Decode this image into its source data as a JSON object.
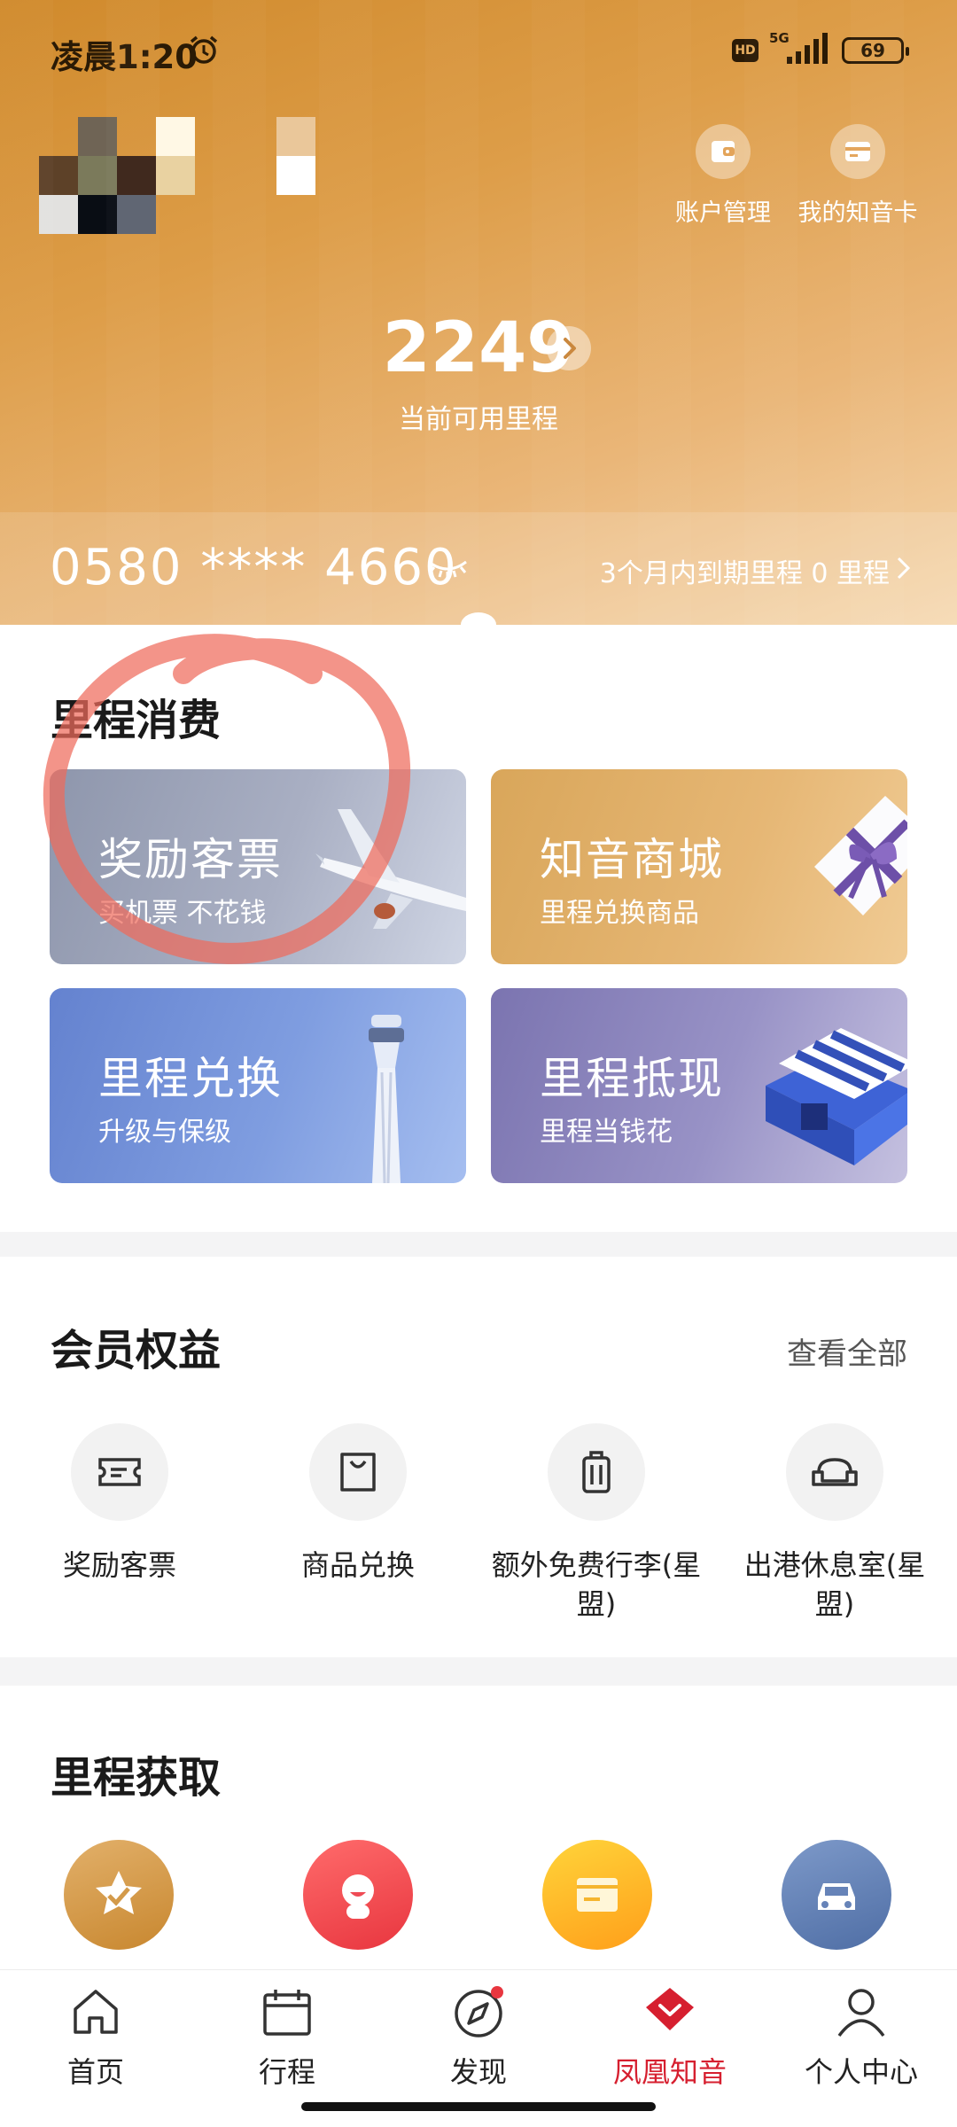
{
  "status_bar": {
    "time": "凌晨1:20",
    "network": "5G",
    "hd_badge": "HD",
    "battery": "69",
    "icons": [
      "alarm-icon",
      "signal-icon",
      "battery-icon"
    ]
  },
  "header": {
    "quick_actions": [
      {
        "label": "账户管理",
        "icon": "wallet-icon"
      },
      {
        "label": "我的知音卡",
        "icon": "card-icon"
      }
    ],
    "miles": "2249",
    "miles_caption": "当前可用里程",
    "card_number": "0580 **** 4660",
    "expire_text": "3个月内到期里程 0 里程"
  },
  "redeem": {
    "title": "里程消费",
    "tiles": [
      {
        "title": "奖励客票",
        "subtitle": "买机票 不花钱",
        "art": "airplane"
      },
      {
        "title": "知音商城",
        "subtitle": "里程兑换商品",
        "art": "gift-box"
      },
      {
        "title": "里程兑换",
        "subtitle": "升级与保级",
        "art": "control-tower"
      },
      {
        "title": "里程抵现",
        "subtitle": "里程当钱花",
        "art": "shop"
      }
    ]
  },
  "benefits": {
    "title": "会员权益",
    "view_all": "查看全部",
    "items": [
      {
        "label": "奖励客票",
        "icon": "ticket-icon"
      },
      {
        "label": "商品兑换",
        "icon": "shopping-bag-icon"
      },
      {
        "label": "额外免费行李(星盟)",
        "icon": "luggage-icon"
      },
      {
        "label": "出港休息室(星盟)",
        "icon": "sofa-icon"
      }
    ]
  },
  "earn": {
    "title": "里程获取",
    "items": [
      {
        "icon": "star-badge-icon"
      },
      {
        "icon": "mascot-icon"
      },
      {
        "icon": "card-icon"
      },
      {
        "icon": "car-icon"
      }
    ]
  },
  "tabbar": {
    "items": [
      {
        "label": "首页",
        "icon": "home-icon"
      },
      {
        "label": "行程",
        "icon": "calendar-icon"
      },
      {
        "label": "发现",
        "icon": "compass-icon"
      },
      {
        "label": "凤凰知音",
        "icon": "phoenix-diamond-icon"
      },
      {
        "label": "个人中心",
        "icon": "user-icon"
      }
    ],
    "active": "凤凰知音"
  },
  "colors": {
    "header_gold": "#dd9d48",
    "active_tab": "#d61f2f",
    "annotation": "#ef6b5b"
  }
}
